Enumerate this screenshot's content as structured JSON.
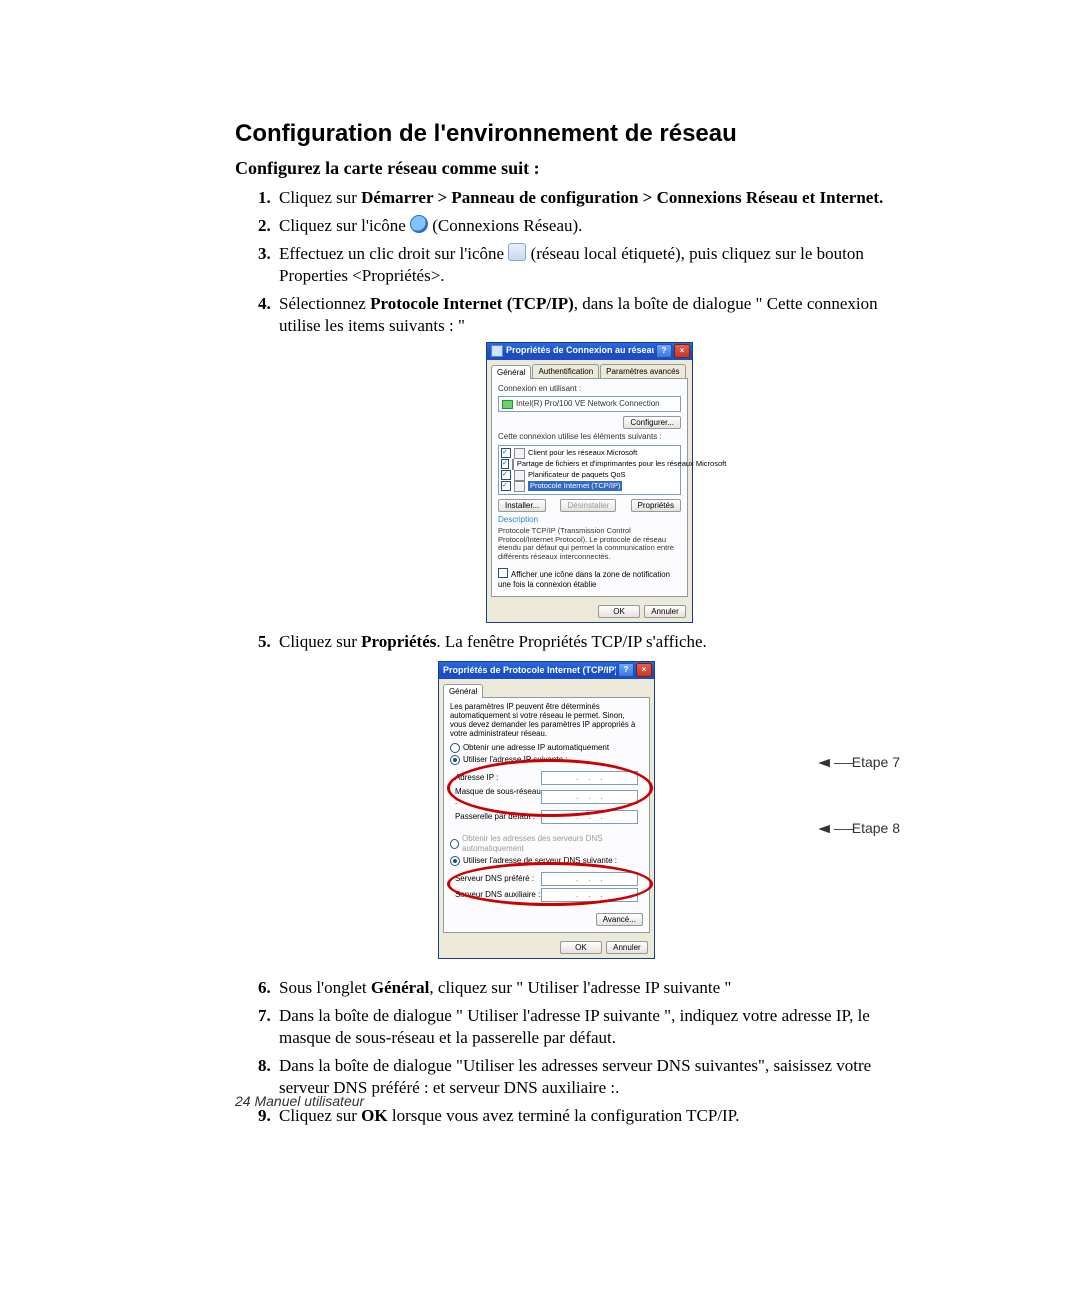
{
  "title": "Configuration de l'environnement de réseau",
  "subtitle": "Configurez la carte réseau comme suit :",
  "steps": {
    "s1a": "Cliquez sur ",
    "s1b": "Démarrer > Panneau de configuration > Connexions Réseau et Internet.",
    "s2a": "Cliquez sur l'icône ",
    "s2b": " (Connexions Réseau).",
    "s3a": "Effectuez un clic droit sur l'icône ",
    "s3b": " (réseau local étiqueté), puis cliquez sur le bouton Properties <Propriétés>.",
    "s4a": "Sélectionnez ",
    "s4b": "Protocole Internet (TCP/IP)",
    "s4c": ", dans la boîte de dialogue \" Cette connexion utilise les items suivants : \"",
    "s5a": "Cliquez sur ",
    "s5b": "Propriétés",
    "s5c": ". La fenêtre Propriétés TCP/IP s'affiche.",
    "s6a": "Sous l'onglet ",
    "s6b": "Général",
    "s6c": ", cliquez sur \" Utiliser l'adresse IP suivante \"",
    "s7": "Dans la boîte de dialogue \" Utiliser l'adresse IP suivante \", indiquez votre adresse IP, le masque de sous-réseau et la passerelle par défaut.",
    "s8": "Dans la boîte de dialogue \"Utiliser les adresses serveur DNS suivantes\", saisissez votre serveur DNS préféré : et serveur DNS auxiliaire :.",
    "s9a": "Cliquez sur ",
    "s9b": "OK",
    "s9c": " lorsque vous avez terminé la configuration TCP/IP."
  },
  "dlg1": {
    "title": "Propriétés de Connexion au réseau local",
    "tabs": {
      "t1": "Général",
      "t2": "Authentification",
      "t3": "Paramètres avancés"
    },
    "connect_label": "Connexion en utilisant :",
    "adapter": "Intel(R) Pro/100 VE Network Connection",
    "btn_configure": "Configurer...",
    "uses_label": "Cette connexion utilise les éléments suivants :",
    "items": {
      "i1": "Client pour les réseaux Microsoft",
      "i2": "Partage de fichiers et d'imprimantes pour les réseaux Microsoft",
      "i3": "Planificateur de paquets QoS",
      "i4": "Protocole Internet (TCP/IP)"
    },
    "btn_install": "Installer...",
    "btn_uninstall": "Désinstaller",
    "btn_props": "Propriétés",
    "desc_title": "Description",
    "desc": "Protocole TCP/IP (Transmission Control Protocol/Internet Protocol). Le protocole de réseau étendu par défaut qui permet la communication entre différents réseaux interconnectés.",
    "show_icon": "Afficher une icône dans la zone de notification une fois la connexion établie",
    "ok": "OK",
    "cancel": "Annuler"
  },
  "dlg2": {
    "title": "Propriétés de Protocole Internet (TCP/IP)",
    "tab": "Général",
    "intro": "Les paramètres IP peuvent être déterminés automatiquement si votre réseau le permet. Sinon, vous devez demander les paramètres IP appropriés à votre administrateur réseau.",
    "r1": "Obtenir une adresse IP automatiquement",
    "r2": "Utiliser l'adresse IP suivante :",
    "f1": "Adresse IP :",
    "f2": "Masque de sous-réseau :",
    "f3": "Passerelle par défaut :",
    "r3": "Obtenir les adresses des serveurs DNS automatiquement",
    "r4": "Utiliser l'adresse de serveur DNS suivante :",
    "f4": "Serveur DNS préféré :",
    "f5": "Serveur DNS auxiliaire :",
    "btn_adv": "Avancé...",
    "ok": "OK",
    "cancel": "Annuler"
  },
  "ann": {
    "e7": "Etape 7",
    "e8": "Etape 8"
  },
  "footer": "24  Manuel utilisateur"
}
